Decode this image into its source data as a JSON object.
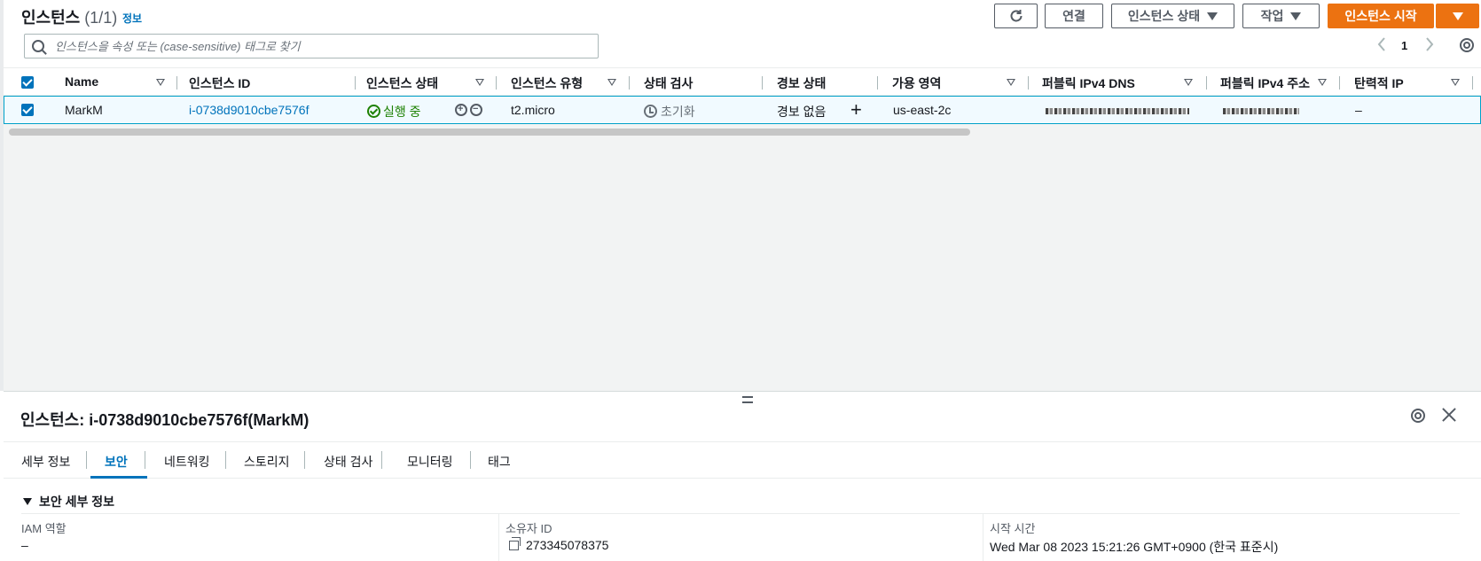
{
  "header": {
    "title": "인스턴스",
    "count": "(1/1)",
    "info_label": "정보"
  },
  "toolbar": {
    "connect_label": "연결",
    "instance_state_label": "인스턴스 상태",
    "actions_label": "작업",
    "launch_label": "인스턴스 시작"
  },
  "search": {
    "placeholder": "인스턴스을 속성 또는 (case-sensitive) 태그로 찾기"
  },
  "pagination": {
    "current_page": "1"
  },
  "table": {
    "columns": [
      "Name",
      "인스턴스 ID",
      "인스턴스 상태",
      "인스턴스 유형",
      "상태 검사",
      "경보 상태",
      "가용 영역",
      "퍼블릭 IPv4 DNS",
      "퍼블릭 IPv4 주소",
      "탄력적 IP"
    ],
    "rows": [
      {
        "name": "MarkM",
        "instance_id": "i-0738d9010cbe7576f",
        "state": "실행 중",
        "type": "t2.micro",
        "status_check": "초기화",
        "alarm_status": "경보 없음",
        "az": "us-east-2c",
        "elastic_ip": "–"
      }
    ]
  },
  "details": {
    "title": "인스턴스: i-0738d9010cbe7576f(MarkM)",
    "tabs": [
      "세부 정보",
      "보안",
      "네트워킹",
      "스토리지",
      "상태 검사",
      "모니터링",
      "태그"
    ],
    "active_tab": "보안",
    "section_title": "보안 세부 정보",
    "fields": {
      "iam_label": "IAM 역할",
      "iam_value": "–",
      "owner_label": "소유자 ID",
      "owner_value": "273345078375",
      "launch_time_label": "시작 시간",
      "launch_time_value": "Wed Mar 08 2023 15:21:26 GMT+0900 (한국 표준시)"
    }
  },
  "colors": {
    "primary": "#ec7211",
    "link": "#0073bb",
    "success": "#1d8102"
  }
}
